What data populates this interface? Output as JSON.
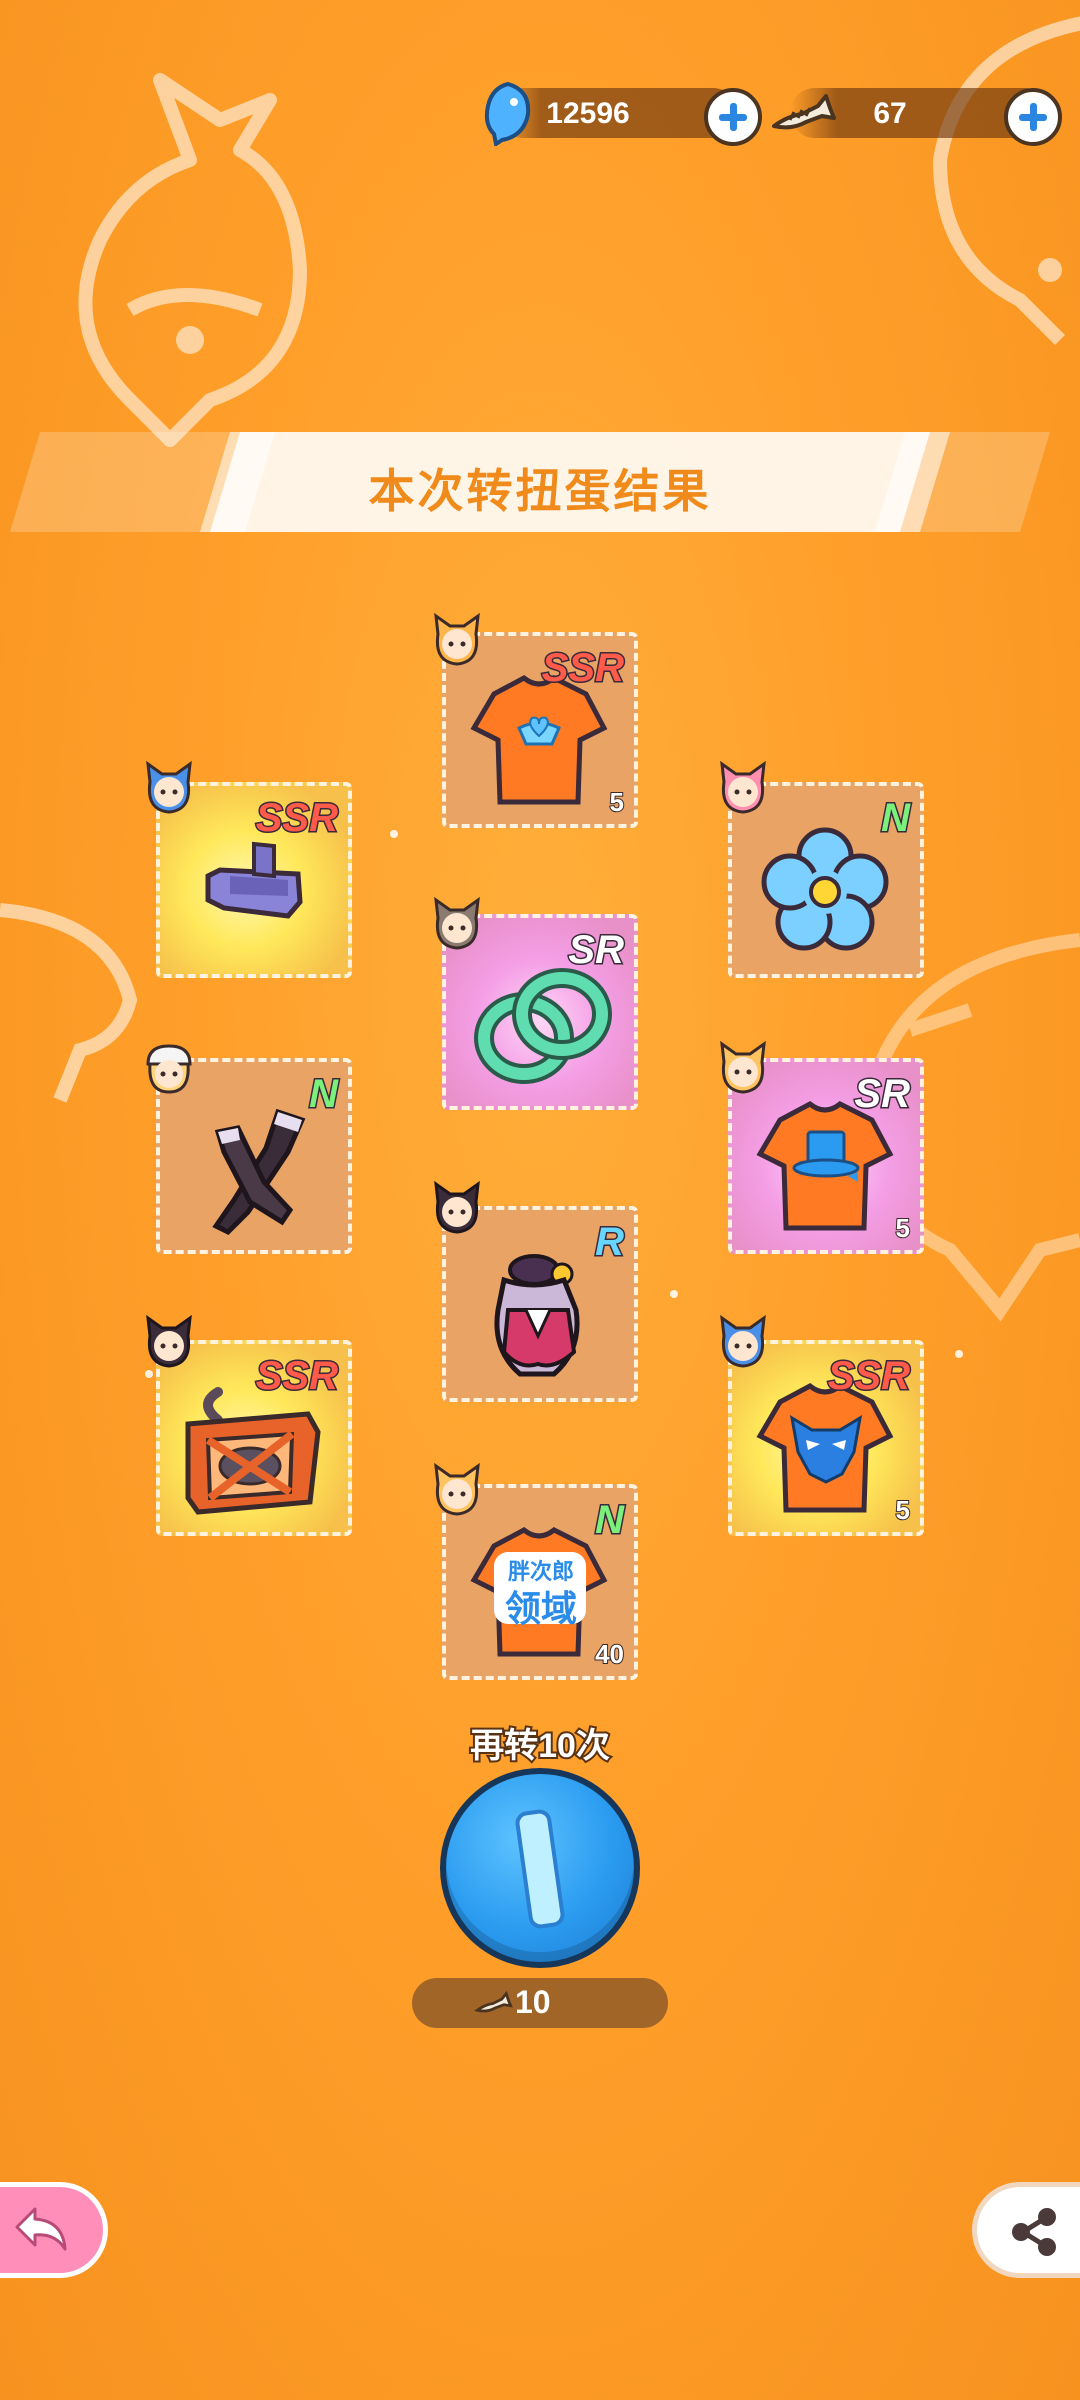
{
  "currency": {
    "gems": {
      "icon": "blue-fish-icon",
      "value": "12596"
    },
    "tickets": {
      "icon": "fishbone-ticket-icon",
      "value": "67"
    }
  },
  "title": "本次转扭蛋结果",
  "items": [
    {
      "rarity": "SSR",
      "item": "orange-shirt-winged-heart",
      "avatar": "cat-girl-orange",
      "qty": "5"
    },
    {
      "rarity": "SSR",
      "item": "purple-bracket",
      "avatar": "cat-girl-blue",
      "qty": ""
    },
    {
      "rarity": "N",
      "item": "blue-flower",
      "avatar": "cat-girl-pink",
      "qty": ""
    },
    {
      "rarity": "SR",
      "item": "green-rings",
      "avatar": "cat-girl-gray",
      "qty": ""
    },
    {
      "rarity": "N",
      "item": "black-stockings",
      "avatar": "cat-girl-blonde-cap",
      "qty": ""
    },
    {
      "rarity": "SR",
      "item": "orange-shirt-top-hat",
      "avatar": "cat-girl-blonde",
      "qty": "5"
    },
    {
      "rarity": "R",
      "item": "red-dress-bell",
      "avatar": "cat-girl-black",
      "qty": ""
    },
    {
      "rarity": "SSR",
      "item": "wooden-crate-cat",
      "avatar": "cat-girl-black-2",
      "qty": ""
    },
    {
      "rarity": "SSR",
      "item": "orange-shirt-mask",
      "avatar": "cat-girl-blue-2",
      "qty": "5"
    },
    {
      "rarity": "N",
      "item": "orange-shirt-text",
      "avatar": "cat-girl-blonde-2",
      "qty": "40",
      "shirt_text": [
        "胖次郎",
        "领域"
      ]
    }
  ],
  "spin": {
    "label": "再转10次",
    "cost": "10",
    "cost_icon": "fishbone-ticket-icon"
  },
  "buttons": {
    "back": "back-arrow-icon",
    "share": "share-icon"
  },
  "colors": {
    "background": "#ff9f2a",
    "title": "#f08a1a",
    "ssr": "#ff5a4a",
    "n": "#7cf07c",
    "r": "#66d6ff"
  }
}
